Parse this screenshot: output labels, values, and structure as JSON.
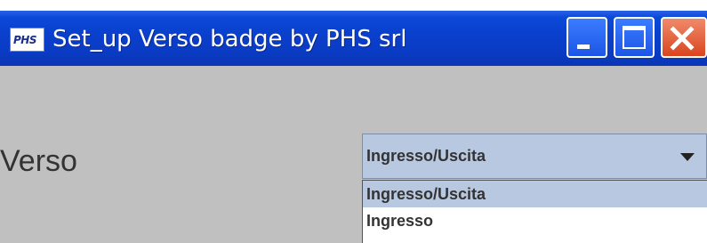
{
  "window": {
    "title": "Set_up Verso badge by PHS srl",
    "app_icon_text": "PHS",
    "colors": {
      "titlebar": "#0a3fcc",
      "client_bg": "#c0c0c0",
      "combo_bg": "#b8c8e0",
      "close_button": "#d9451f"
    }
  },
  "titlebar_buttons": {
    "minimize_icon": "minimize-icon",
    "maximize_icon": "maximize-icon",
    "close_icon": "close-icon"
  },
  "form": {
    "verso_label": "Verso",
    "verso_select": {
      "selected": "Ingresso/Uscita",
      "options": [
        "Ingresso/Uscita",
        "Ingresso"
      ]
    }
  }
}
